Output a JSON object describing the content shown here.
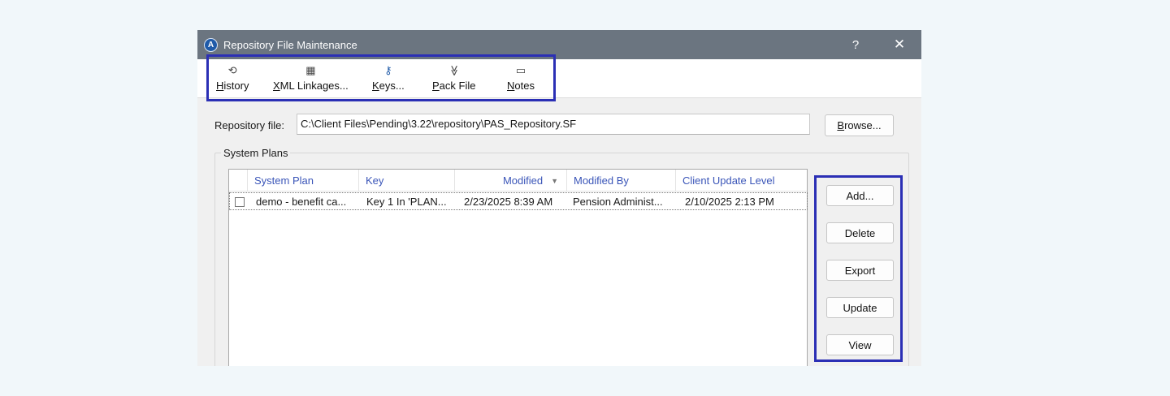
{
  "window": {
    "title": "Repository File Maintenance",
    "app_icon_letter": "A",
    "help_glyph": "?",
    "close_glyph": "✕"
  },
  "toolbar": {
    "items": [
      {
        "icon": "history-icon",
        "glyph": "⟲",
        "mnemonic": "H",
        "rest": "istory"
      },
      {
        "icon": "grid-icon",
        "glyph": "▦",
        "mnemonic": "X",
        "rest": "ML Linkages..."
      },
      {
        "icon": "key-icon",
        "glyph": "⚷",
        "mnemonic": "K",
        "rest": "eys..."
      },
      {
        "icon": "chevrons-down-icon",
        "glyph": "≫",
        "mnemonic": "P",
        "rest": "ack File"
      },
      {
        "icon": "note-icon",
        "glyph": "▭",
        "mnemonic": "N",
        "rest": "otes"
      }
    ]
  },
  "repository": {
    "label": "Repository file:",
    "value": "C:\\Client Files\\Pending\\3.22\\repository\\PAS_Repository.SF",
    "browse_mnemonic": "B",
    "browse_rest": "rowse..."
  },
  "system_plans": {
    "group_label": "System Plans",
    "columns": [
      "System Plan",
      "Key",
      "Modified",
      "Modified By",
      "Client Update Level"
    ],
    "sort_glyph": "▼",
    "rows": [
      {
        "system_plan": "demo - benefit ca...",
        "key": "Key 1 In 'PLAN...",
        "modified": "2/23/2025  8:39 AM",
        "modified_by": "Pension Administ...",
        "client_update_level": "2/10/2025  2:13 PM"
      }
    ]
  },
  "actions": {
    "add": "Add...",
    "delete": "Delete",
    "export": "Export",
    "update": "Update",
    "view": "View"
  },
  "colors": {
    "highlight": "#2b2fb5",
    "titlebar": "#6b7580",
    "header_text": "#3a55b8"
  }
}
